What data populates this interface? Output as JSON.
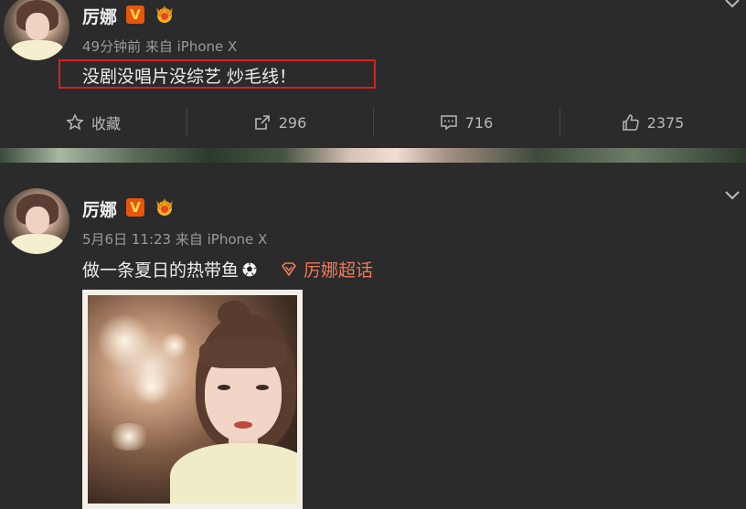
{
  "post1": {
    "author": "厉娜",
    "verified_mark": "V",
    "time": "49分钟前",
    "source": "来自 iPhone X",
    "text": "没剧没唱片没综艺 炒毛线！",
    "actions": {
      "favorite_label": "收藏",
      "repost_count": "296",
      "comment_count": "716",
      "like_count": "2375"
    }
  },
  "post2": {
    "author": "厉娜",
    "verified_mark": "V",
    "time": "5月6日 11:23",
    "source": "来自 iPhone X",
    "text": "做一条夏日的热带鱼",
    "topic": "厉娜超话"
  },
  "colors": {
    "background": "#2b2b2b",
    "verified": "#e8560b",
    "topic_link": "#ee7a5a",
    "highlight_box": "#d62020"
  },
  "icons": [
    "chevron-down-icon",
    "star-icon",
    "share-icon",
    "comment-icon",
    "thumbs-up-icon",
    "verified-v-icon",
    "crown-badge-icon",
    "soccer-ball-emoji-icon",
    "supertopic-diamond-icon"
  ]
}
